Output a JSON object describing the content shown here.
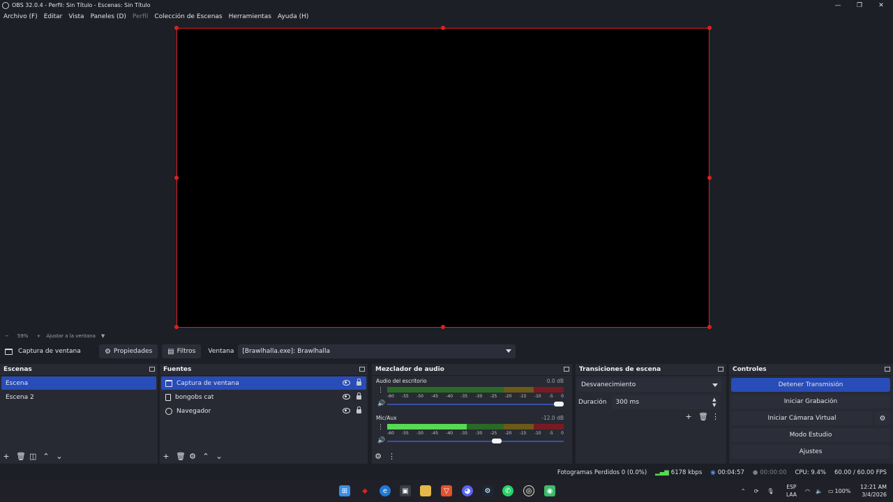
{
  "window": {
    "title": "OBS 32.0.4 - Perfil: Sin Título - Escenas: Sin Título",
    "minimize_glyph": "—",
    "maximize_glyph": "❐",
    "close_glyph": "✕"
  },
  "menu": [
    "Archivo (F)",
    "Editar",
    "Vista",
    "Paneles (D)",
    "Perfil",
    "Colección de Escenas",
    "Herramientas",
    "Ayuda (H)"
  ],
  "zoom": {
    "minus": "−",
    "level": "59%",
    "plus": "+",
    "fit_label": "Ajustar a la ventana"
  },
  "source_bar": {
    "source_name": "Captura de ventana",
    "properties_label": "Propiedades",
    "filters_label": "Filtros",
    "window_label": "Ventana",
    "window_value": "[Brawlhalla.exe]: Brawlhalla"
  },
  "scenes": {
    "title": "Escenas",
    "items": [
      "Escena",
      "Escena 2"
    ],
    "selected": 0
  },
  "sources": {
    "title": "Fuentes",
    "items": [
      {
        "label": "Captura de ventana",
        "icon": "window-capture-icon"
      },
      {
        "label": "bongobs cat",
        "icon": "file-icon"
      },
      {
        "label": "Navegador",
        "icon": "globe-icon"
      }
    ],
    "selected": 0
  },
  "mixer": {
    "title": "Mezclador de audio",
    "channels": [
      {
        "name": "Audio del escritorio",
        "db": "0.0 dB",
        "level": 0.0,
        "volume": 1.0
      },
      {
        "name": "Mic/Aux",
        "db": "-12.0 dB",
        "level": 0.45,
        "volume": 0.65
      }
    ],
    "ticks": [
      "-60",
      "-55",
      "-50",
      "-45",
      "-40",
      "-35",
      "-30",
      "-25",
      "-20",
      "-15",
      "-10",
      "-5",
      "0"
    ]
  },
  "transitions": {
    "title": "Transiciones de escena",
    "selected": "Desvanecimiento",
    "duration_label": "Duración",
    "duration_value": "300 ms"
  },
  "controls": {
    "title": "Controles",
    "stop_stream": "Detener Transmisión",
    "start_recording": "Iniciar Grabación",
    "start_virtual_cam": "Iniciar Cámara Virtual",
    "studio_mode": "Modo Estudio",
    "settings": "Ajustes"
  },
  "status": {
    "dropped_frames": "Fotogramas Perdidos 0 (0.0%)",
    "bitrate": "6178 kbps",
    "stream_time": "00:04:57",
    "record_time": "00:00:00",
    "cpu": "CPU: 9.4%",
    "fps": "60.00 / 60.00 FPS"
  },
  "taskbar": {
    "lang_top": "ESP",
    "lang_bottom": "LAA",
    "battery": "100%",
    "time": "12:21 AM",
    "date": "3/4/2026"
  },
  "colors": {
    "accent": "#284cb8",
    "bounding_box": "#e0201d",
    "background": "#1d1f26",
    "panel": "#272a33"
  }
}
